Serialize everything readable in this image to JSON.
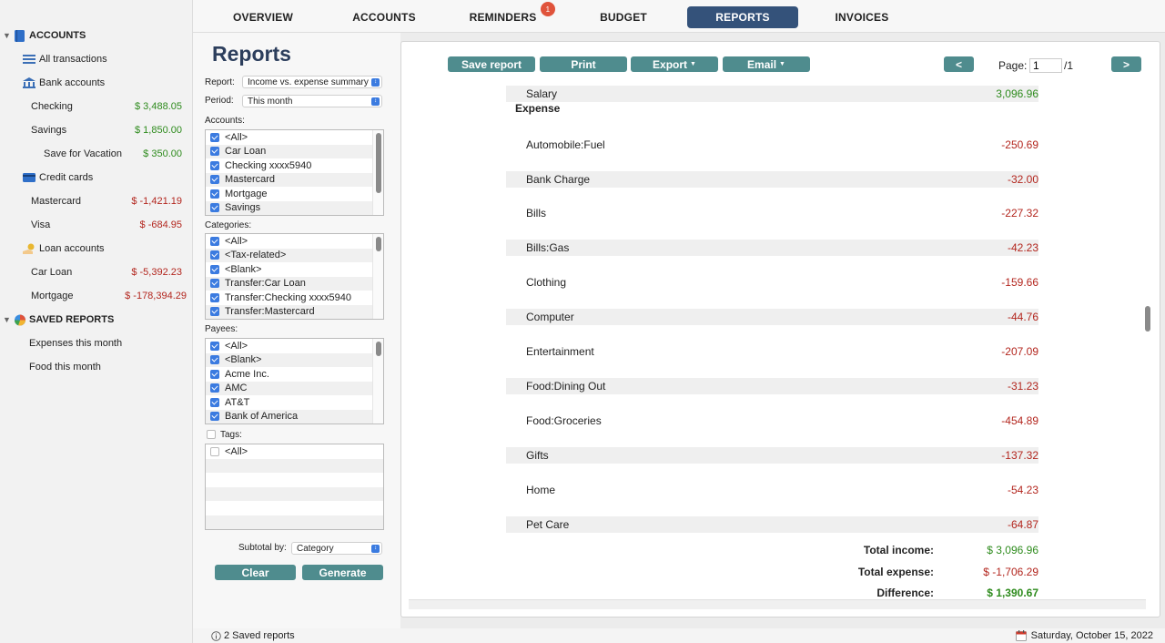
{
  "sidebar": {
    "accounts_header": "ACCOUNTS",
    "all_transactions": "All transactions",
    "bank_accounts": "Bank accounts",
    "bank_items": [
      {
        "label": "Checking",
        "amount": "$ 3,488.05"
      },
      {
        "label": "Savings",
        "amount": "$ 1,850.00"
      },
      {
        "label": "Save for Vacation",
        "amount": "$ 350.00"
      }
    ],
    "credit_cards": "Credit cards",
    "credit_items": [
      {
        "label": "Mastercard",
        "amount": "$ -1,421.19"
      },
      {
        "label": "Visa",
        "amount": "$ -684.95"
      }
    ],
    "loan_accounts": "Loan accounts",
    "loan_items": [
      {
        "label": "Car Loan",
        "amount": "$ -5,392.23"
      },
      {
        "label": "Mortgage",
        "amount": "$ -178,394.29"
      }
    ],
    "saved_reports_header": "SAVED REPORTS",
    "saved_reports": [
      "Expenses this month",
      "Food this month"
    ]
  },
  "tabs": {
    "overview": "OVERVIEW",
    "accounts": "ACCOUNTS",
    "reminders": "REMINDERS",
    "reminders_badge": "1",
    "budget": "BUDGET",
    "reports": "REPORTS",
    "invoices": "INVOICES"
  },
  "filters": {
    "title": "Reports",
    "report_label": "Report:",
    "report_value": "Income vs. expense summary",
    "period_label": "Period:",
    "period_value": "This month",
    "accounts_label": "Accounts:",
    "accounts": [
      "<All>",
      "Car Loan",
      "Checking xxxx5940",
      "Mastercard",
      "Mortgage",
      "Savings"
    ],
    "categories_label": "Categories:",
    "categories": [
      "<All>",
      "<Tax-related>",
      "<Blank>",
      "Transfer:Car Loan",
      "Transfer:Checking xxxx5940",
      "Transfer:Mastercard"
    ],
    "payees_label": "Payees:",
    "payees": [
      "<All>",
      "<Blank>",
      "Acme Inc.",
      "AMC",
      "AT&T",
      "Bank of America"
    ],
    "tags_label": "Tags:",
    "tags": [
      "<All>"
    ],
    "subtotal_label": "Subtotal by:",
    "subtotal_value": "Category",
    "clear": "Clear",
    "generate": "Generate"
  },
  "toolbar": {
    "save_report": "Save report",
    "print": "Print",
    "export": "Export",
    "email": "Email",
    "prev": "<",
    "page_label": "Page:",
    "page_value": "1",
    "page_total": "/1",
    "next": ">"
  },
  "report": {
    "income_rows": [
      {
        "name": "Salary",
        "value": "3,096.96"
      }
    ],
    "expense_header": "Expense",
    "expense_rows": [
      {
        "name": "Automobile:Fuel",
        "value": "-250.69"
      },
      {
        "name": "Bank Charge",
        "value": "-32.00"
      },
      {
        "name": "Bills",
        "value": "-227.32"
      },
      {
        "name": "Bills:Gas",
        "value": "-42.23"
      },
      {
        "name": "Clothing",
        "value": "-159.66"
      },
      {
        "name": "Computer",
        "value": "-44.76"
      },
      {
        "name": "Entertainment",
        "value": "-207.09"
      },
      {
        "name": "Food:Dining Out",
        "value": "-31.23"
      },
      {
        "name": "Food:Groceries",
        "value": "-454.89"
      },
      {
        "name": "Gifts",
        "value": "-137.32"
      },
      {
        "name": "Home",
        "value": "-54.23"
      },
      {
        "name": "Pet Care",
        "value": "-64.87"
      }
    ],
    "total_income_label": "Total income:",
    "total_income": "$ 3,096.96",
    "total_expense_label": "Total expense:",
    "total_expense": "$ -1,706.29",
    "difference_label": "Difference:",
    "difference": "$ 1,390.67"
  },
  "status": {
    "saved_reports": "2 Saved reports",
    "date": "Saturday, October 15, 2022"
  },
  "colors": {
    "accent": "#34527a",
    "button": "#4f8c8e",
    "positive": "#2e8b1d",
    "negative": "#b3261e"
  }
}
